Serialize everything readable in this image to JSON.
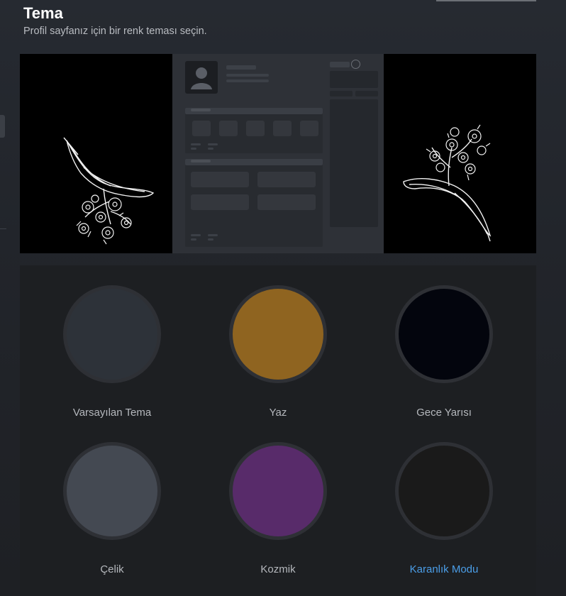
{
  "header": {
    "title": "Tema",
    "subtitle": "Profil sayfanız için bir renk teması seçin."
  },
  "themes": [
    {
      "label": "Varsayılan Tema",
      "color": "#2d3239",
      "selected": false
    },
    {
      "label": "Yaz",
      "color": "#8f6420",
      "selected": false
    },
    {
      "label": "Gece Yarısı",
      "color": "#03050d",
      "selected": false
    },
    {
      "label": "Çelik",
      "color": "#444952",
      "selected": false
    },
    {
      "label": "Kozmik",
      "color": "#582b6a",
      "selected": false
    },
    {
      "label": "Karanlık Modu",
      "color": "#1a1a1a",
      "selected": true
    }
  ],
  "colors": {
    "selected_label": "#4b9ee8",
    "label": "#b5b8bd"
  }
}
